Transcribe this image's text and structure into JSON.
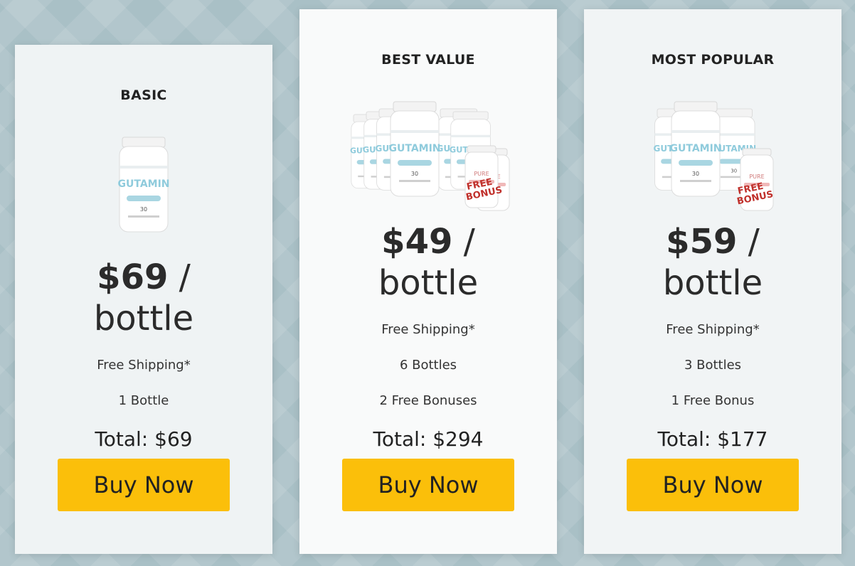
{
  "plans": [
    {
      "tier": "BASIC",
      "price": "$69",
      "price_suffix": " /",
      "price_unit": "bottle",
      "shipping": "Free Shipping*",
      "bottles": "1 Bottle",
      "bonus": "",
      "total": "Total: $69",
      "button": "Buy Now",
      "image_label": "GUTAMIN"
    },
    {
      "tier": "BEST VALUE",
      "price": "$49",
      "price_suffix": " /",
      "price_unit": "bottle",
      "shipping": "Free Shipping*",
      "bottles": "6 Bottles",
      "bonus": "2 Free Bonuses",
      "total": "Total: $294",
      "button": "Buy Now",
      "image_label": "GUTAMIN",
      "bonus_badge": "FREE BONUS"
    },
    {
      "tier": "MOST POPULAR",
      "price": "$59",
      "price_suffix": " /",
      "price_unit": "bottle",
      "shipping": "Free Shipping*",
      "bottles": "3 Bottles",
      "bonus": "1 Free Bonus",
      "total": "Total: $177",
      "button": "Buy Now",
      "image_label": "GUTAMIN",
      "bonus_badge": "FREE BONUS"
    }
  ],
  "colors": {
    "button": "#fbbf0a",
    "bottle_accent": "#8fcbdc",
    "badge_red": "#c0302b"
  }
}
